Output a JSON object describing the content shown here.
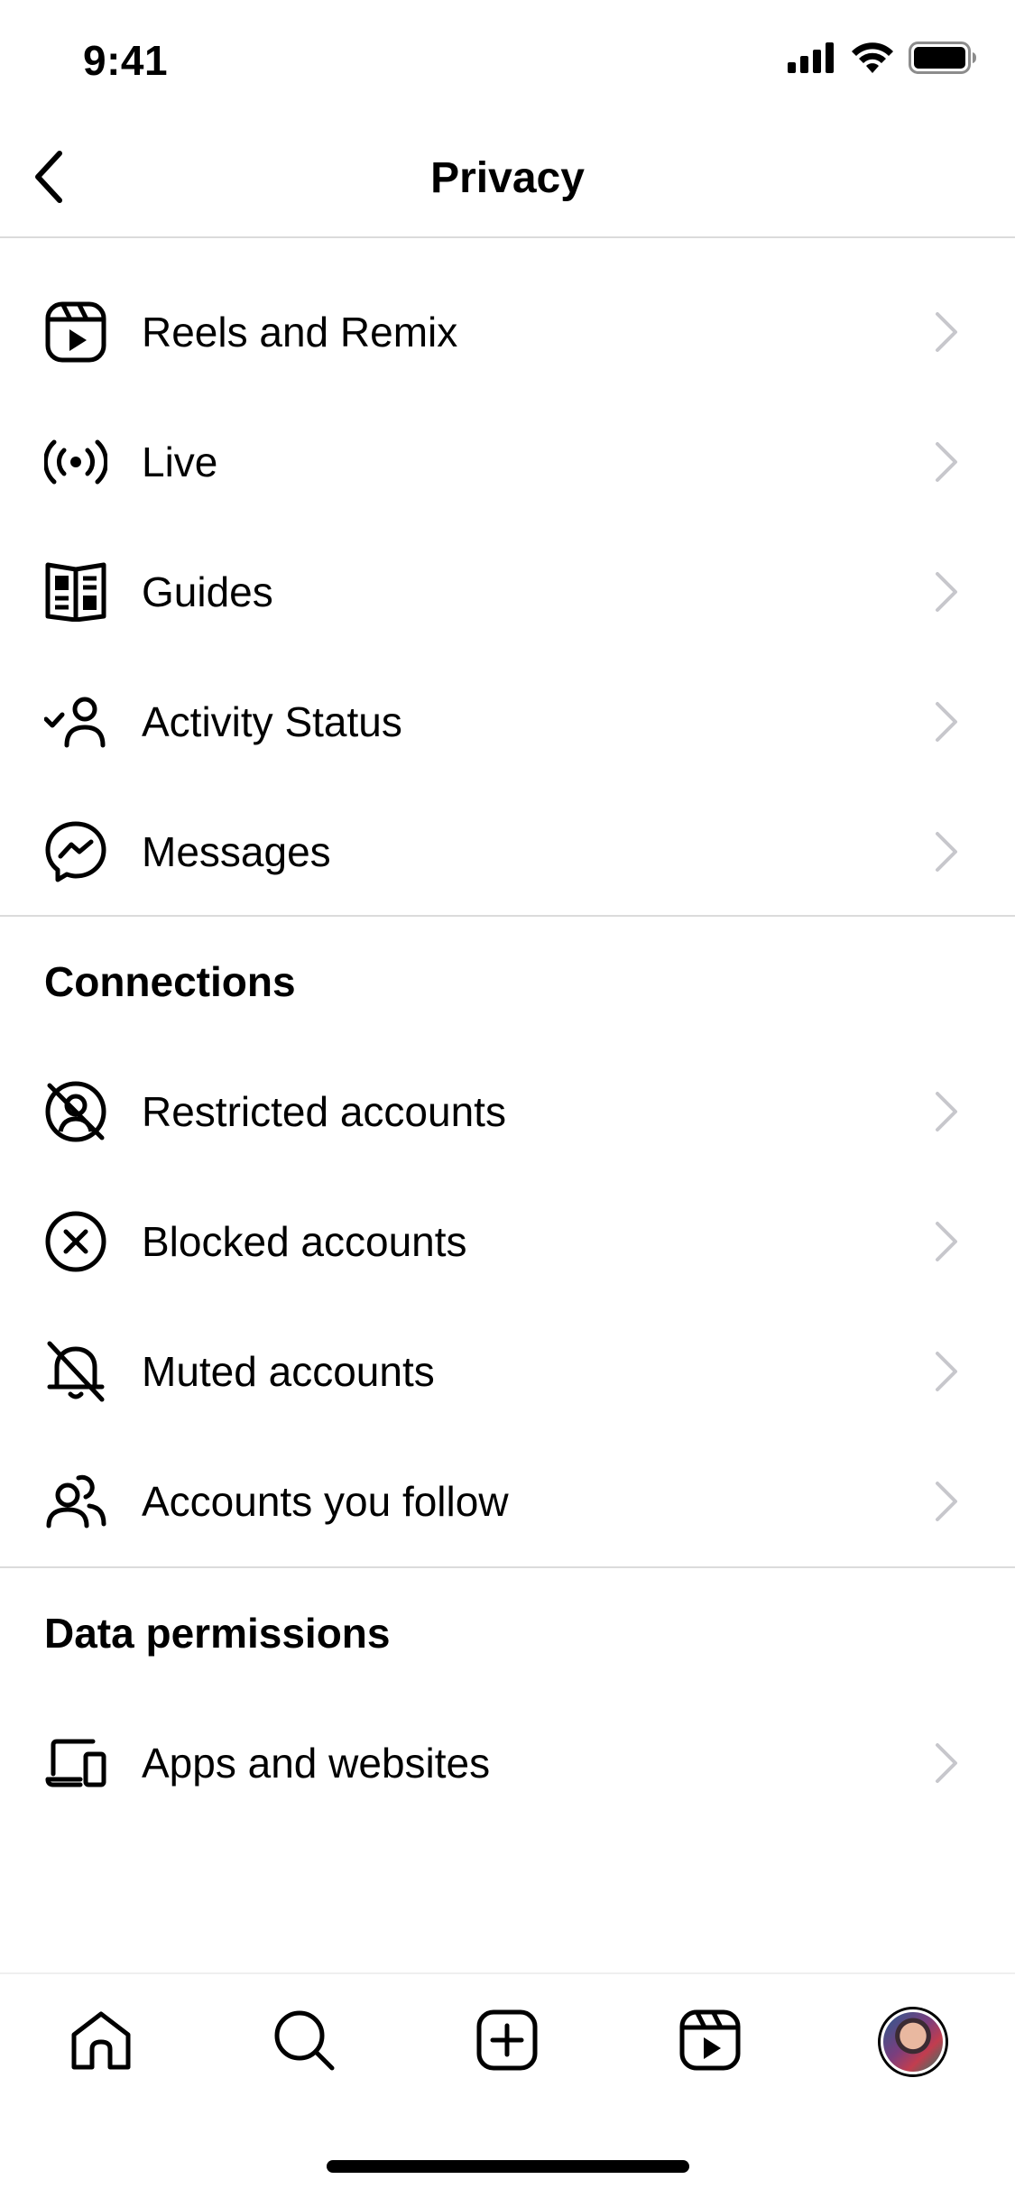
{
  "status_bar": {
    "time": "9:41"
  },
  "header": {
    "title": "Privacy",
    "back_icon": "chevron-left-icon"
  },
  "sections": {
    "top": {
      "items": [
        {
          "label": "Reels and Remix",
          "icon": "reels-icon"
        },
        {
          "label": "Live",
          "icon": "live-broadcast-icon"
        },
        {
          "label": "Guides",
          "icon": "guides-book-icon"
        },
        {
          "label": "Activity Status",
          "icon": "activity-status-icon"
        },
        {
          "label": "Messages",
          "icon": "messenger-icon"
        }
      ]
    },
    "connections": {
      "title": "Connections",
      "items": [
        {
          "label": "Restricted accounts",
          "icon": "restricted-user-icon"
        },
        {
          "label": "Blocked accounts",
          "icon": "blocked-x-icon"
        },
        {
          "label": "Muted accounts",
          "icon": "muted-bell-icon"
        },
        {
          "label": "Accounts you follow",
          "icon": "people-icon"
        }
      ]
    },
    "data_permissions": {
      "title": "Data permissions",
      "items": [
        {
          "label": "Apps and websites",
          "icon": "devices-icon"
        }
      ]
    }
  },
  "tab_bar": {
    "tabs": [
      {
        "icon": "home-icon"
      },
      {
        "icon": "search-icon"
      },
      {
        "icon": "create-post-icon"
      },
      {
        "icon": "reels-icon"
      },
      {
        "icon": "profile-avatar"
      }
    ]
  },
  "colors": {
    "divider": "#dbdbdb",
    "chevron": "#c7c7cc",
    "text": "#000000",
    "background": "#ffffff"
  }
}
